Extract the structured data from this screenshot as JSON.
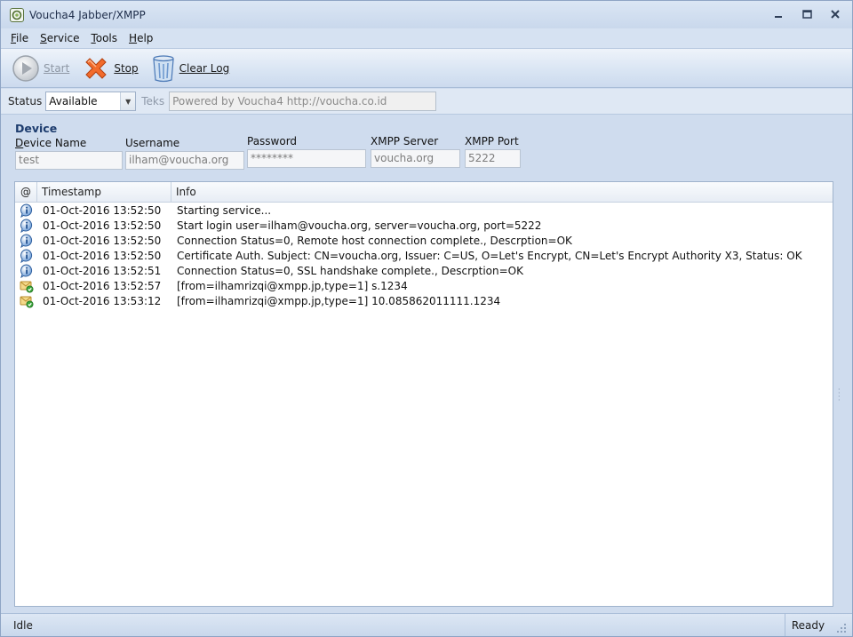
{
  "window": {
    "title": "Voucha4 Jabber/XMPP",
    "min_glyph": "▁",
    "max_glyph": "▣",
    "close_glyph": "✕",
    "icon": "app-logo-icon"
  },
  "menu": {
    "items": [
      {
        "mnemonic": "F",
        "rest": "ile"
      },
      {
        "mnemonic": "S",
        "rest": "ervice"
      },
      {
        "mnemonic": "T",
        "rest": "ools"
      },
      {
        "mnemonic": "H",
        "rest": "elp"
      }
    ]
  },
  "toolbar": {
    "start_label": "Start",
    "stop_label": "Stop",
    "clear_label": "Clear Log",
    "icons": [
      "play-icon",
      "stop-x-icon",
      "trash-bin-icon"
    ]
  },
  "status_row": {
    "status_label": "Status",
    "status_value": "Available",
    "teks_label": "Teks",
    "teks_value": "Powered by Voucha4 http://voucha.co.id"
  },
  "device": {
    "title": "Device",
    "device_name": {
      "label_mnemonic": "D",
      "label_rest": "evice Name",
      "value": "test"
    },
    "username": {
      "label": "Username",
      "value": "ilham@voucha.org"
    },
    "password": {
      "label": "Password",
      "value": "********"
    },
    "xmpp_server": {
      "label": "XMPP Server",
      "value": "voucha.org"
    },
    "xmpp_port": {
      "label": "XMPP Port",
      "value": "5222"
    }
  },
  "log": {
    "columns": [
      "@",
      "Timestamp",
      "Info"
    ],
    "rows": [
      {
        "icon": "info-icon",
        "timestamp": "01-Oct-2016 13:52:50",
        "info": "Starting service..."
      },
      {
        "icon": "info-icon",
        "timestamp": "01-Oct-2016 13:52:50",
        "info": "Start login user=ilham@voucha.org, server=voucha.org, port=5222"
      },
      {
        "icon": "info-icon",
        "timestamp": "01-Oct-2016 13:52:50",
        "info": "Connection Status=0, Remote host connection complete., Descrption=OK"
      },
      {
        "icon": "info-icon",
        "timestamp": "01-Oct-2016 13:52:50",
        "info": "Certificate Auth. Subject: CN=voucha.org, Issuer: C=US, O=Let's Encrypt, CN=Let's Encrypt Authority X3, Status: OK"
      },
      {
        "icon": "info-icon",
        "timestamp": "01-Oct-2016 13:52:51",
        "info": "Connection Status=0, SSL handshake complete., Descrption=OK"
      },
      {
        "icon": "message-received-icon",
        "timestamp": "01-Oct-2016 13:52:57",
        "info": "[from=ilhamrizqi@xmpp.jp,type=1] s.1234"
      },
      {
        "icon": "message-received-icon",
        "timestamp": "01-Oct-2016 13:53:12",
        "info": "[from=ilhamrizqi@xmpp.jp,type=1] 10.085862011111.1234"
      }
    ]
  },
  "statusbar": {
    "left": "Idle",
    "right": "Ready"
  }
}
